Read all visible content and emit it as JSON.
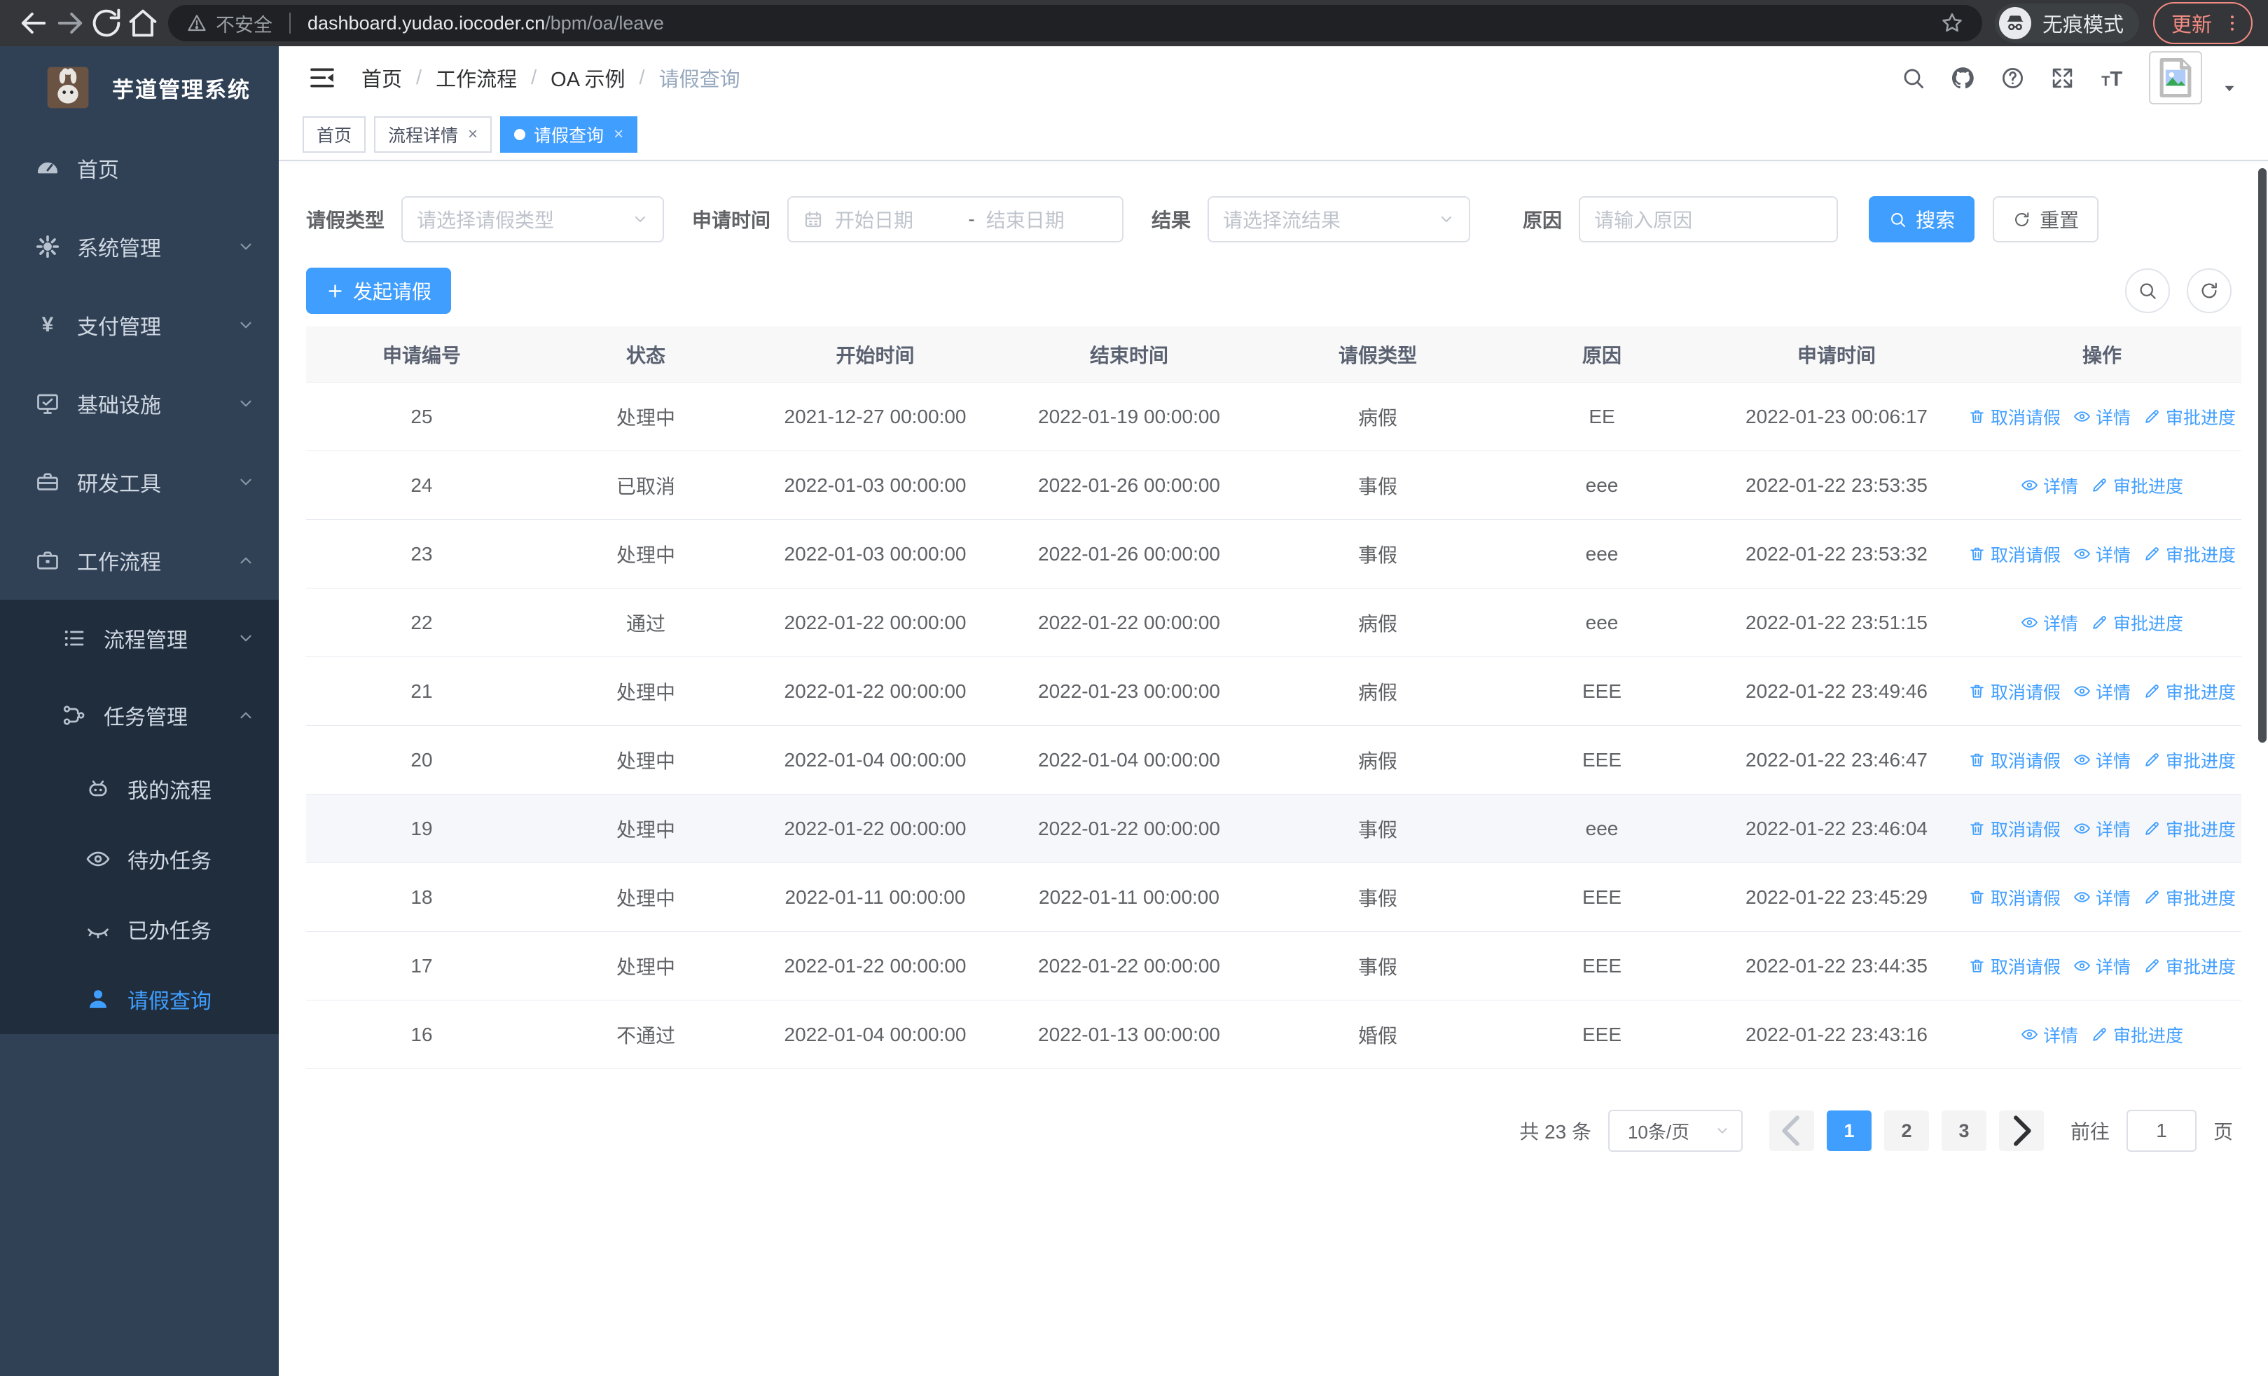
{
  "browser": {
    "security_label": "不安全",
    "url_host": "dashboard.yudao.iocoder.cn",
    "url_path": "/bpm/oa/leave",
    "incognito_label": "无痕模式",
    "update_label": "更新"
  },
  "sidebar": {
    "logo_title": "芋道管理系统",
    "menu": [
      {
        "label": "首页",
        "icon": "dashboard",
        "chevron": ""
      },
      {
        "label": "系统管理",
        "icon": "gear",
        "chevron": "down"
      },
      {
        "label": "支付管理",
        "icon": "yen",
        "chevron": "down"
      },
      {
        "label": "基础设施",
        "icon": "monitor",
        "chevron": "down"
      },
      {
        "label": "研发工具",
        "icon": "toolbox",
        "chevron": "down"
      },
      {
        "label": "工作流程",
        "icon": "briefcase",
        "chevron": "up"
      }
    ],
    "submenu": [
      {
        "label": "流程管理",
        "icon": "list",
        "chevron": "down",
        "level": 2,
        "active": false
      },
      {
        "label": "任务管理",
        "icon": "flow",
        "chevron": "up",
        "level": 2,
        "active": false
      },
      {
        "label": "我的流程",
        "icon": "robot",
        "chevron": "",
        "level": 3,
        "active": false
      },
      {
        "label": "待办任务",
        "icon": "eye",
        "chevron": "",
        "level": 3,
        "active": false
      },
      {
        "label": "已办任务",
        "icon": "eye-closed",
        "chevron": "",
        "level": 3,
        "active": false
      },
      {
        "label": "请假查询",
        "icon": "user",
        "chevron": "",
        "level": 3,
        "active": true
      }
    ]
  },
  "topbar": {
    "breadcrumb": [
      "首页",
      "工作流程",
      "OA 示例",
      "请假查询"
    ],
    "icons": [
      "search",
      "github",
      "question",
      "fullscreen",
      "font-size"
    ]
  },
  "tabs": [
    {
      "label": "首页",
      "closable": false,
      "active": false
    },
    {
      "label": "流程详情",
      "closable": true,
      "active": false
    },
    {
      "label": "请假查询",
      "closable": true,
      "active": true
    }
  ],
  "ui": {
    "close_glyph": "×",
    "breadcrumb_separator": "/"
  },
  "filters": {
    "leave_type_label": "请假类型",
    "leave_type_placeholder": "请选择请假类型",
    "apply_time_label": "申请时间",
    "start_placeholder": "开始日期",
    "range_separator": "-",
    "end_placeholder": "结束日期",
    "result_label": "结果",
    "result_placeholder": "请选择流结果",
    "reason_label": "原因",
    "reason_placeholder": "请输入原因",
    "search_label": "搜索",
    "reset_label": "重置"
  },
  "toolbar": {
    "create_label": "发起请假"
  },
  "table": {
    "columns": [
      "申请编号",
      "状态",
      "开始时间",
      "结束时间",
      "请假类型",
      "原因",
      "申请时间",
      "操作"
    ],
    "action_labels": {
      "cancel": "取消请假",
      "detail": "详情",
      "progress": "审批进度"
    },
    "rows": [
      {
        "id": "25",
        "status": "处理中",
        "start": "2021-12-27 00:00:00",
        "end": "2022-01-19 00:00:00",
        "type": "病假",
        "reason": "EE",
        "applied": "2022-01-23 00:06:17",
        "actions": [
          "cancel",
          "detail",
          "progress"
        ],
        "highlighted": false
      },
      {
        "id": "24",
        "status": "已取消",
        "start": "2022-01-03 00:00:00",
        "end": "2022-01-26 00:00:00",
        "type": "事假",
        "reason": "eee",
        "applied": "2022-01-22 23:53:35",
        "actions": [
          "detail",
          "progress"
        ],
        "highlighted": false
      },
      {
        "id": "23",
        "status": "处理中",
        "start": "2022-01-03 00:00:00",
        "end": "2022-01-26 00:00:00",
        "type": "事假",
        "reason": "eee",
        "applied": "2022-01-22 23:53:32",
        "actions": [
          "cancel",
          "detail",
          "progress"
        ],
        "highlighted": false
      },
      {
        "id": "22",
        "status": "通过",
        "start": "2022-01-22 00:00:00",
        "end": "2022-01-22 00:00:00",
        "type": "病假",
        "reason": "eee",
        "applied": "2022-01-22 23:51:15",
        "actions": [
          "detail",
          "progress"
        ],
        "highlighted": false
      },
      {
        "id": "21",
        "status": "处理中",
        "start": "2022-01-22 00:00:00",
        "end": "2022-01-23 00:00:00",
        "type": "病假",
        "reason": "EEE",
        "applied": "2022-01-22 23:49:46",
        "actions": [
          "cancel",
          "detail",
          "progress"
        ],
        "highlighted": false
      },
      {
        "id": "20",
        "status": "处理中",
        "start": "2022-01-04 00:00:00",
        "end": "2022-01-04 00:00:00",
        "type": "病假",
        "reason": "EEE",
        "applied": "2022-01-22 23:46:47",
        "actions": [
          "cancel",
          "detail",
          "progress"
        ],
        "highlighted": false
      },
      {
        "id": "19",
        "status": "处理中",
        "start": "2022-01-22 00:00:00",
        "end": "2022-01-22 00:00:00",
        "type": "事假",
        "reason": "eee",
        "applied": "2022-01-22 23:46:04",
        "actions": [
          "cancel",
          "detail",
          "progress"
        ],
        "highlighted": true
      },
      {
        "id": "18",
        "status": "处理中",
        "start": "2022-01-11 00:00:00",
        "end": "2022-01-11 00:00:00",
        "type": "事假",
        "reason": "EEE",
        "applied": "2022-01-22 23:45:29",
        "actions": [
          "cancel",
          "detail",
          "progress"
        ],
        "highlighted": false
      },
      {
        "id": "17",
        "status": "处理中",
        "start": "2022-01-22 00:00:00",
        "end": "2022-01-22 00:00:00",
        "type": "事假",
        "reason": "EEE",
        "applied": "2022-01-22 23:44:35",
        "actions": [
          "cancel",
          "detail",
          "progress"
        ],
        "highlighted": false
      },
      {
        "id": "16",
        "status": "不通过",
        "start": "2022-01-04 00:00:00",
        "end": "2022-01-13 00:00:00",
        "type": "婚假",
        "reason": "EEE",
        "applied": "2022-01-22 23:43:16",
        "actions": [
          "detail",
          "progress"
        ],
        "highlighted": false
      }
    ]
  },
  "pagination": {
    "total_label": "共 23 条",
    "page_size_label": "10条/页",
    "pages": [
      "1",
      "2",
      "3"
    ],
    "active_page": "1",
    "goto_label": "前往",
    "goto_value": "1",
    "unit_label": "页"
  },
  "colors": {
    "accent": "#409eff",
    "sidebar_bg": "#304156",
    "submenu_bg": "#1f2d3d"
  }
}
